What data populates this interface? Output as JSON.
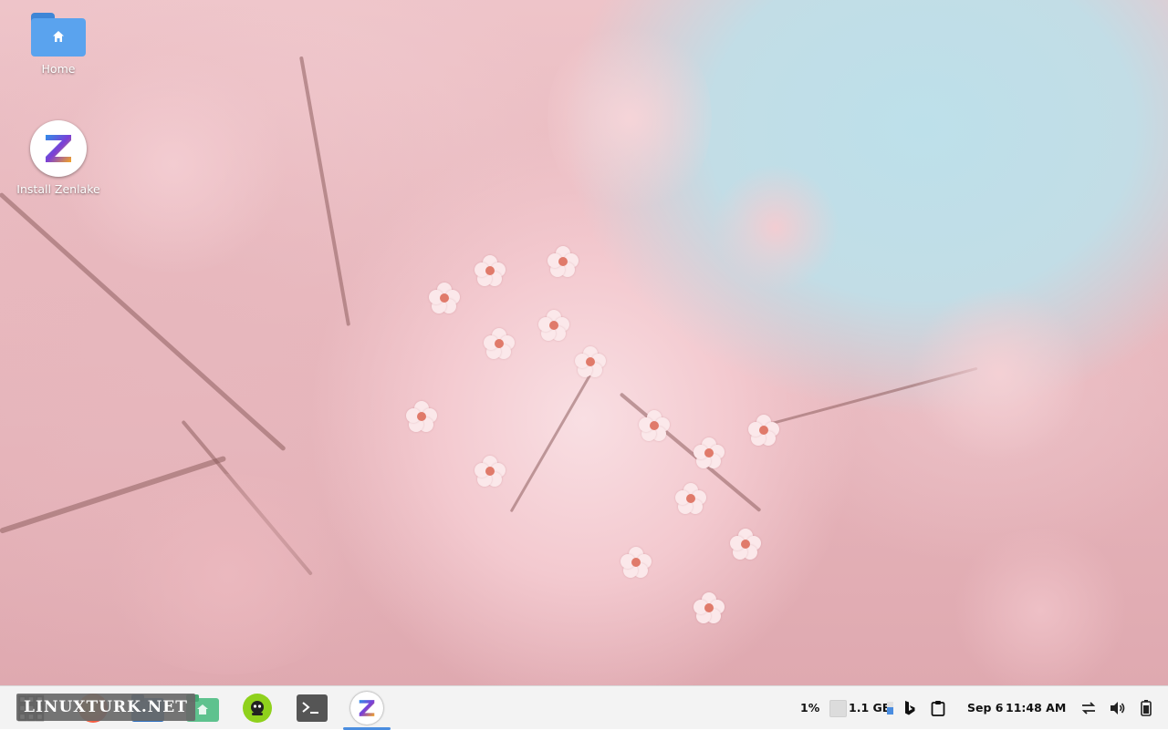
{
  "desktop": {
    "icons": [
      {
        "label": "Home",
        "icon": "home-folder-icon"
      },
      {
        "label": "Install Zenlake",
        "icon": "zenlake-logo-icon"
      }
    ]
  },
  "taskbar": {
    "launcher_icon": "app-grid-icon",
    "apps": [
      {
        "name": "firefox-icon"
      },
      {
        "name": "file-manager-icon"
      },
      {
        "name": "home-folder-icon"
      },
      {
        "name": "app-store-icon"
      },
      {
        "name": "terminal-icon"
      },
      {
        "name": "zenlake-installer-icon"
      }
    ],
    "tray": {
      "cpu": "1%",
      "memory": "1.1 GB",
      "date": "Sep 6",
      "time": "11:48 AM"
    },
    "tray_icons": [
      "bing-icon",
      "clipboard-icon",
      "network-icon",
      "volume-icon",
      "battery-icon"
    ]
  },
  "watermark": "LINUXTURK.NET",
  "colors": {
    "sky": "#bde0ea",
    "blossom": "#f3c9cf",
    "taskbar": "#f3f3f3",
    "folder": "#5aa3ee",
    "accent_active": "#4a8de0"
  }
}
